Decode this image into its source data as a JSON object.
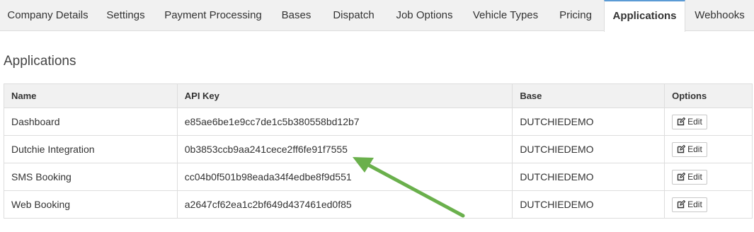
{
  "tabs": [
    {
      "label": "Company Details",
      "active": false
    },
    {
      "label": "Settings",
      "active": false
    },
    {
      "label": "Payment Processing",
      "active": false
    },
    {
      "label": "Bases",
      "active": false
    },
    {
      "label": "Dispatch",
      "active": false
    },
    {
      "label": "Job Options",
      "active": false
    },
    {
      "label": "Vehicle Types",
      "active": false
    },
    {
      "label": "Pricing",
      "active": false
    },
    {
      "label": "Applications",
      "active": true
    },
    {
      "label": "Webhooks",
      "active": false
    }
  ],
  "page": {
    "title": "Applications"
  },
  "table": {
    "headers": {
      "name": "Name",
      "api_key": "API Key",
      "base": "Base",
      "options": "Options"
    },
    "rows": [
      {
        "name": "Dashboard",
        "api_key": "e85ae6be1e9cc7de1c5b380558bd12b7",
        "base": "DUTCHIEDEMO",
        "action": "Edit"
      },
      {
        "name": "Dutchie Integration",
        "api_key": "0b3853ccb9aa241cece2ff6fe91f7555",
        "base": "DUTCHIEDEMO",
        "action": "Edit"
      },
      {
        "name": "SMS Booking",
        "api_key": "cc04b0f501b98eada34f4edbe8f9d551",
        "base": "DUTCHIEDEMO",
        "action": "Edit"
      },
      {
        "name": "Web Booking",
        "api_key": "a2647cf62ea1c2bf649d437461ed0f85",
        "base": "DUTCHIEDEMO",
        "action": "Edit"
      }
    ]
  },
  "icons": {
    "edit": "edit-icon",
    "annotation": "arrow-annotation"
  },
  "colors": {
    "active_tab_accent": "#5b9bd5",
    "annotation_arrow": "#6ab04c"
  }
}
